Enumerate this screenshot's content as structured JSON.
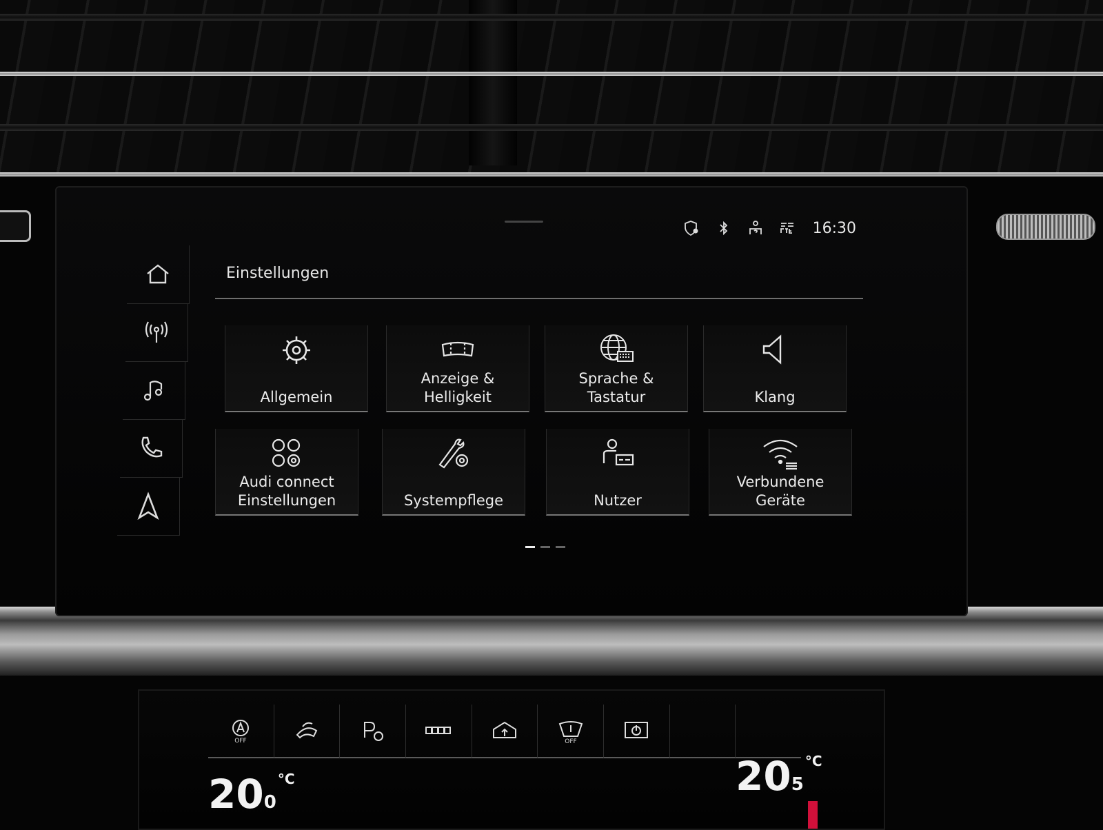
{
  "status": {
    "time": "16:30"
  },
  "sidebar": {
    "items": [
      {
        "name": "home",
        "icon": "home-icon"
      },
      {
        "name": "radio",
        "icon": "radio-antenna-icon"
      },
      {
        "name": "media",
        "icon": "music-note-icon"
      },
      {
        "name": "phone",
        "icon": "phone-icon"
      },
      {
        "name": "navigation",
        "icon": "navigation-arrow-icon"
      }
    ]
  },
  "header": {
    "title": "Einstellungen"
  },
  "tiles": [
    {
      "label": "Allgemein",
      "icon": "gear-icon"
    },
    {
      "label": "Anzeige & Helligkeit",
      "line1": "Anzeige &",
      "line2": "Helligkeit",
      "icon": "display-icon"
    },
    {
      "label": "Sprache & Tastatur",
      "line1": "Sprache &",
      "line2": "Tastatur",
      "icon": "globe-keyboard-icon"
    },
    {
      "label": "Klang",
      "icon": "speaker-icon"
    },
    {
      "label": "Audi connect Einstellungen",
      "line1": "Audi connect",
      "line2": "Einstellungen",
      "icon": "audi-connect-icon"
    },
    {
      "label": "Systempflege",
      "icon": "wrench-gear-icon"
    },
    {
      "label": "Nutzer",
      "icon": "user-icon"
    },
    {
      "label": "Verbundene Geräte",
      "line1": "Verbundene",
      "line2": "Geräte",
      "icon": "wifi-devices-icon"
    }
  ],
  "pager": {
    "pages": 3,
    "current": 1
  },
  "climate": {
    "left_temp": "20",
    "left_dec": "0",
    "right_temp": "20",
    "right_dec": "5",
    "unit": "°C",
    "auto_off_label": "OFF",
    "wiper_off_label": "OFF"
  }
}
